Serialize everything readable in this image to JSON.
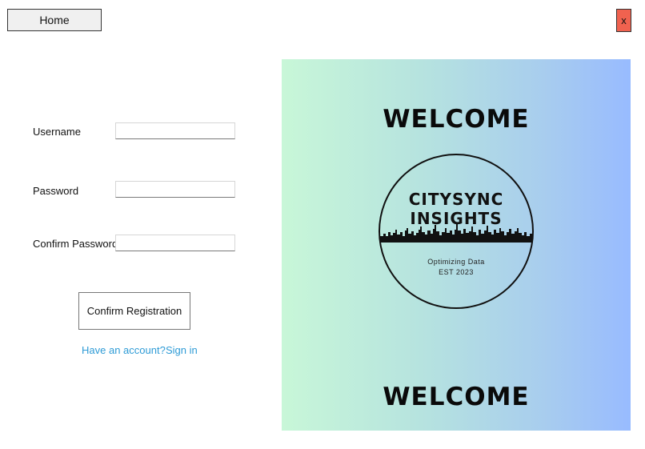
{
  "toolbar": {
    "home_label": "Home",
    "close_label": "x"
  },
  "form": {
    "username_label": "Username",
    "username_value": "",
    "password_label": "Password",
    "password_value": "",
    "confirm_password_label": "Confirm Password",
    "confirm_password_value": "",
    "confirm_button_label": "Confirm Registration",
    "have_account_text": "Have an account?",
    "sign_in_link": "Sign in"
  },
  "banner": {
    "welcome_top": "WELCOME",
    "logo_line1": "CITYSYNC",
    "logo_line2": "INSIGHTS",
    "tagline": "Optimizing Data",
    "established": "EST 2023",
    "welcome_bottom": "WELCOME"
  },
  "colors": {
    "close_button": "#f0624f",
    "link": "#2e9bd6",
    "gradient_start": "#c8f7d8",
    "gradient_end": "#98bbff"
  }
}
